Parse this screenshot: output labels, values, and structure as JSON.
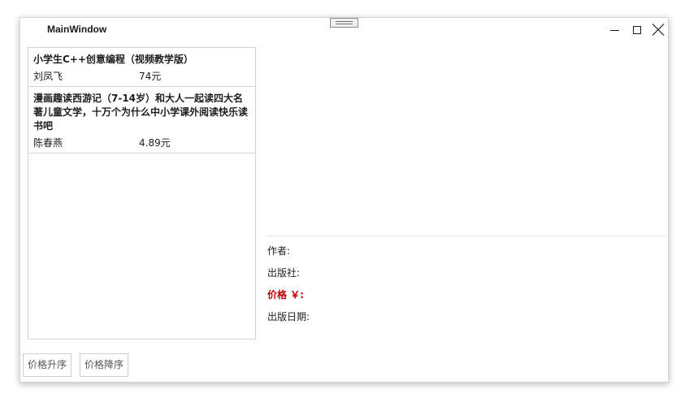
{
  "window": {
    "title": "MainWindow"
  },
  "books": [
    {
      "title": "小学生C++创意编程（视频教学版）",
      "author": "刘凤飞",
      "price": "74元"
    },
    {
      "title": "漫画趣读西游记（7-14岁）和大人一起读四大名著儿童文学，十万个为什么中小学课外阅读快乐读书吧",
      "author": "陈春燕",
      "price": "4.89元"
    }
  ],
  "details": {
    "author_label": "作者:",
    "publisher_label": "出版社:",
    "price_label": "价格 ￥:",
    "date_label": "出版日期:"
  },
  "buttons": {
    "sort_asc": "价格升序",
    "sort_desc": "价格降序"
  },
  "colors": {
    "price_accent": "#c00000"
  }
}
